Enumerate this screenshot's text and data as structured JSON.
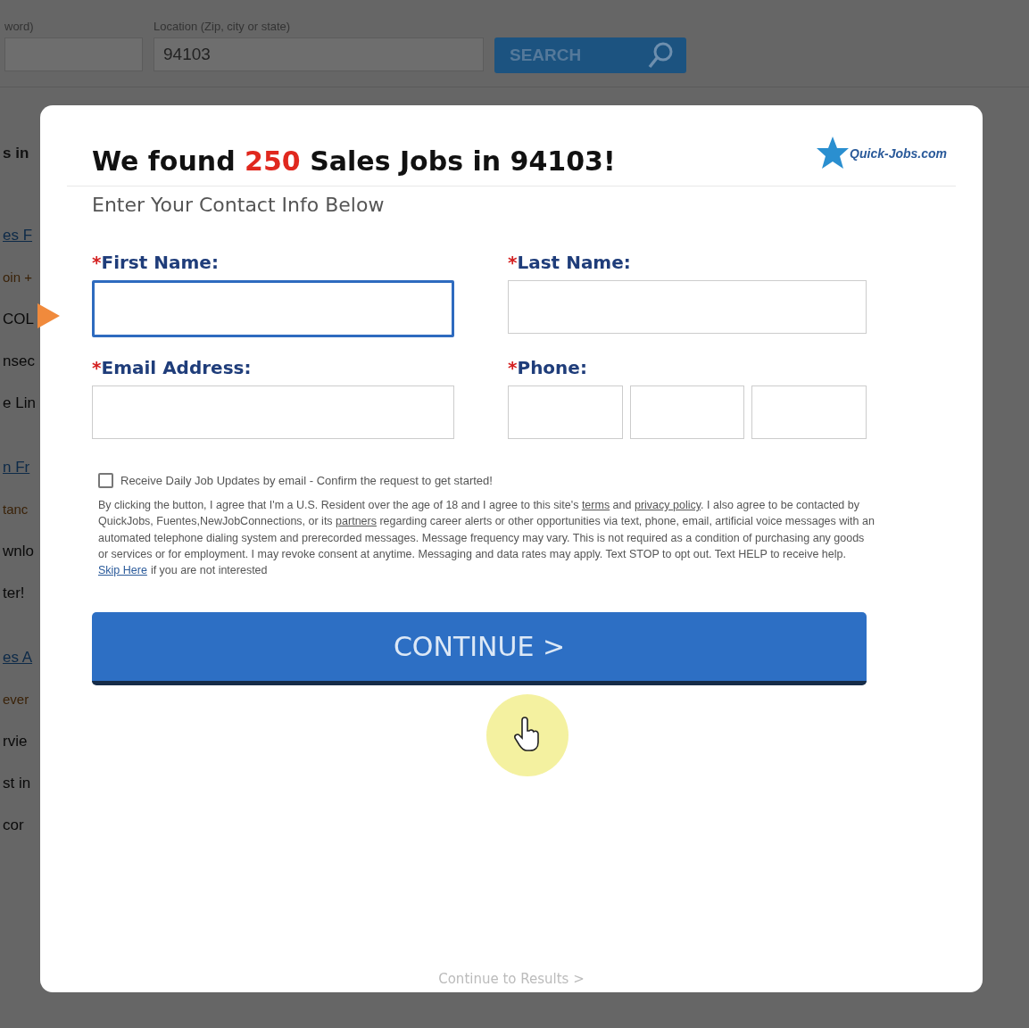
{
  "background_page": {
    "keyword_label": "word)",
    "location_label": "Location (Zip, city or state)",
    "location_value": "94103",
    "search_button": "SEARCH",
    "fragments": [
      {
        "text": "s in",
        "kind": "heading"
      },
      {
        "text": "es F",
        "kind": "link"
      },
      {
        "text": "oin +",
        "kind": "accent"
      },
      {
        "text": "COL",
        "kind": "plain"
      },
      {
        "text": "nsec",
        "kind": "plain"
      },
      {
        "text": "e Lin",
        "kind": "plain"
      },
      {
        "text": "n Fr",
        "kind": "link"
      },
      {
        "text": "tanc",
        "kind": "accent"
      },
      {
        "text": "wnlo",
        "kind": "plain"
      },
      {
        "text": "ter!",
        "kind": "plain"
      },
      {
        "text": "es A",
        "kind": "link"
      },
      {
        "text": "ever",
        "kind": "accent"
      },
      {
        "text": "rvie",
        "kind": "plain"
      },
      {
        "text": "st in",
        "kind": "plain"
      },
      {
        "text": "cor",
        "kind": "plain"
      }
    ]
  },
  "modal": {
    "title_before": "We found",
    "count": "250",
    "title_after": "Sales Jobs in 94103!",
    "logo_text": "Quick-Jobs.com",
    "subtitle": "Enter Your Contact Info Below",
    "fields": [
      {
        "label": "First Name:",
        "required_mark": "*",
        "kind": "text",
        "focused": true
      },
      {
        "label": "Last Name:",
        "required_mark": "*",
        "kind": "text",
        "focused": false
      },
      {
        "label": "Email Address:",
        "required_mark": "*",
        "kind": "text",
        "focused": false
      },
      {
        "label": "Phone:",
        "required_mark": "*",
        "kind": "phone",
        "focused": false
      }
    ],
    "updates_checkbox": {
      "label": "Receive Daily Job Updates by email - Confirm the request to get started!",
      "checked": false
    },
    "consent_segments": [
      {
        "text": "By clicking the button, I agree that I'm a U.S. Resident over the age of 18 and I agree to this site's ",
        "link": false
      },
      {
        "text": "terms",
        "link": true
      },
      {
        "text": " and ",
        "link": false
      },
      {
        "text": "privacy policy",
        "link": true
      },
      {
        "text": ". I also agree to be contacted by QuickJobs, Fuentes,NewJobConnections, or its ",
        "link": false
      },
      {
        "text": "partners",
        "link": true
      },
      {
        "text": " regarding career alerts or other opportunities via text, phone, email, artificial voice messages with an automated telephone dialing system and prerecorded messages. Message frequency may vary. This is not required as a condition of purchasing any goods or services or for employment. I may revoke consent at anytime. Messaging and data rates may apply. Text STOP to opt out. Text HELP to receive help.",
        "link": false
      }
    ],
    "skip_link": "Skip Here",
    "skip_text": "if you are not interested",
    "continue_button": "CONTINUE >",
    "results_link": "Continue to Results >"
  }
}
